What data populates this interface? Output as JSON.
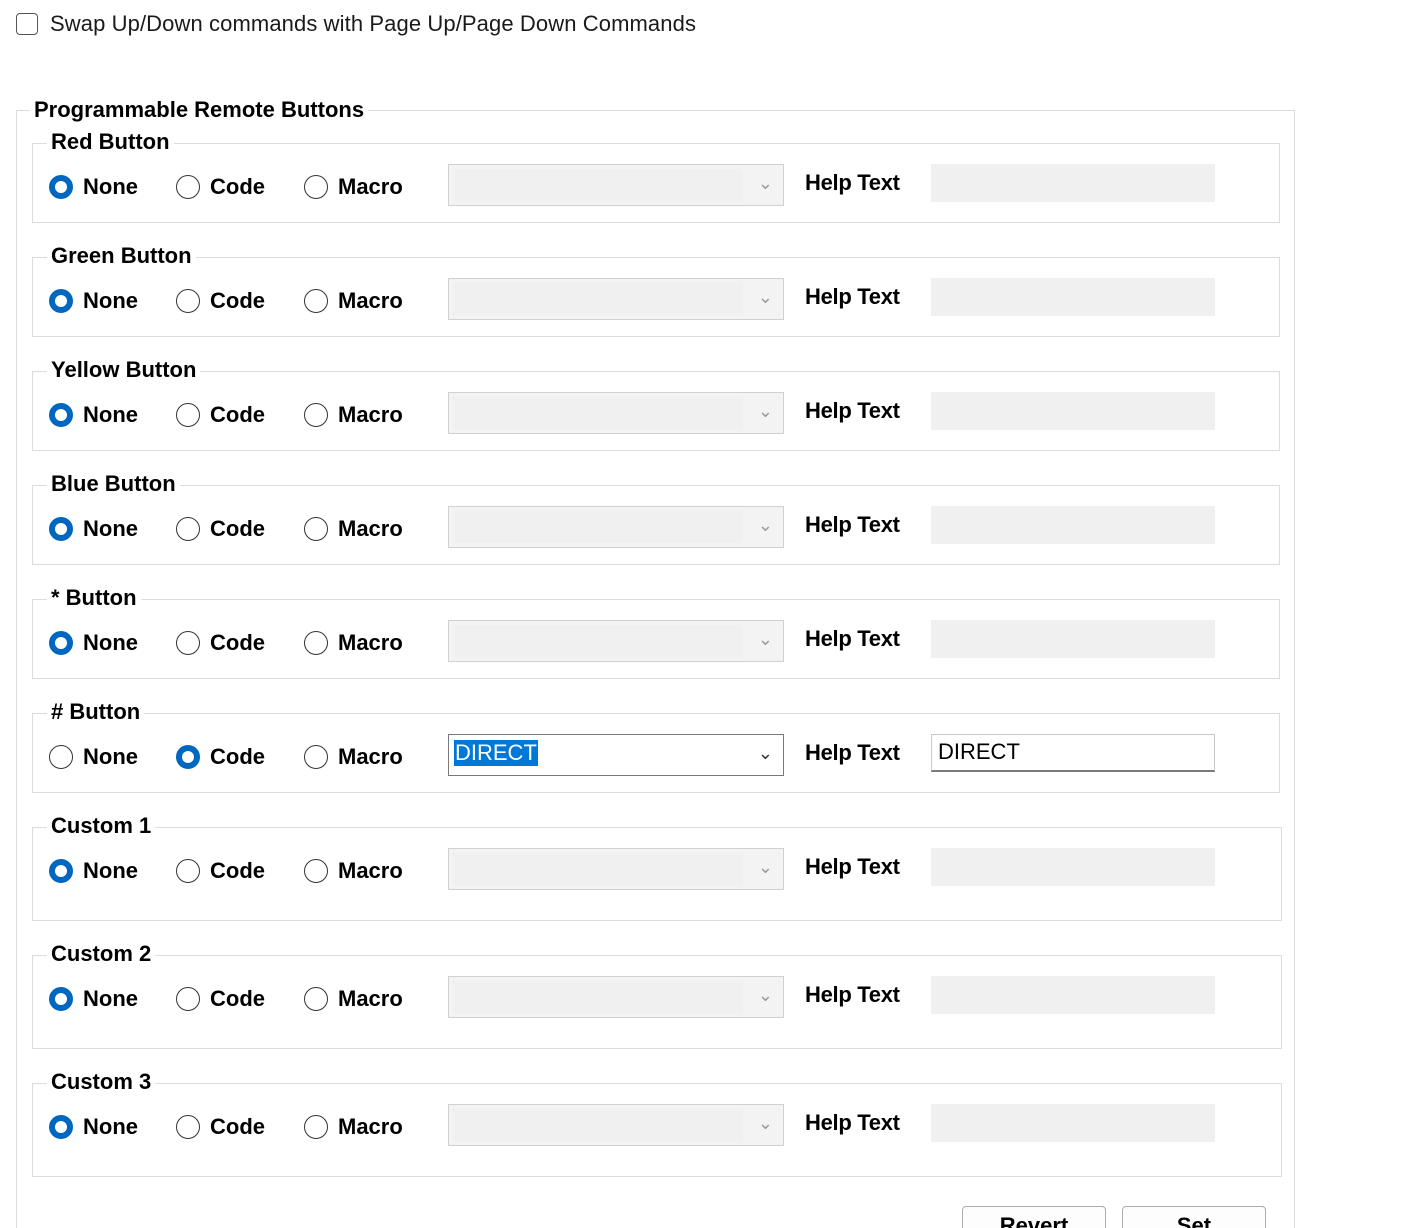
{
  "swap": {
    "label": "Swap Up/Down commands with Page Up/Page Down Commands",
    "checked": false
  },
  "group_title": "Programmable Remote Buttons",
  "options": [
    "None",
    "Code",
    "Macro"
  ],
  "help_label": "Help Text",
  "buttons": [
    {
      "name": "Red Button",
      "selected": "None",
      "combo_value": "",
      "help_text": ""
    },
    {
      "name": "Green Button",
      "selected": "None",
      "combo_value": "",
      "help_text": ""
    },
    {
      "name": "Yellow Button",
      "selected": "None",
      "combo_value": "",
      "help_text": ""
    },
    {
      "name": "Blue Button",
      "selected": "None",
      "combo_value": "",
      "help_text": ""
    },
    {
      "name": "* Button",
      "selected": "None",
      "combo_value": "",
      "help_text": ""
    },
    {
      "name": "# Button",
      "selected": "Code",
      "combo_value": "DIRECT",
      "help_text": "DIRECT"
    },
    {
      "name": "Custom 1",
      "selected": "None",
      "combo_value": "",
      "help_text": ""
    },
    {
      "name": "Custom 2",
      "selected": "None",
      "combo_value": "",
      "help_text": ""
    },
    {
      "name": "Custom 3",
      "selected": "None",
      "combo_value": "",
      "help_text": ""
    }
  ],
  "actions": {
    "revert_label": "Revert",
    "set_label": "Set"
  },
  "colors": {
    "radio_checked": "#0067c0",
    "selection_highlight": "#0078d7"
  }
}
